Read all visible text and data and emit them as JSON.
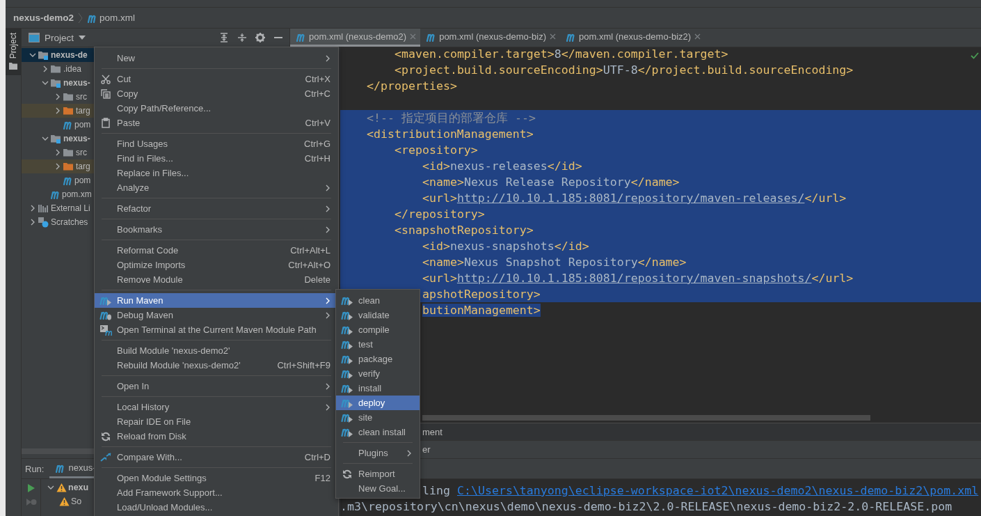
{
  "breadcrumb": [
    {
      "label": "nexus-demo2",
      "kind": "project"
    },
    {
      "label": "pom.xml",
      "kind": "maven"
    }
  ],
  "tool_windows": [
    {
      "label": "Project",
      "selected": true
    }
  ],
  "project_panel": {
    "title": "Project",
    "tree": [
      {
        "label": "nexus-de",
        "kind": "module",
        "expanded": true,
        "selected": true,
        "children": [
          {
            "label": ".idea",
            "kind": "folder",
            "expanded": false,
            "selected": false
          },
          {
            "label": "nexus-",
            "kind": "module",
            "expanded": true,
            "selected": false,
            "children": [
              {
                "label": "src",
                "kind": "folder",
                "expanded": false,
                "selected": false
              },
              {
                "label": "targ",
                "kind": "excluded",
                "expanded": false,
                "selected": false
              },
              {
                "label": "pom",
                "kind": "maven",
                "selected": false
              }
            ]
          },
          {
            "label": "nexus-",
            "kind": "module",
            "expanded": true,
            "selected": false,
            "children": [
              {
                "label": "src",
                "kind": "folder",
                "expanded": false,
                "selected": false
              },
              {
                "label": "targ",
                "kind": "excluded",
                "expanded": false,
                "selected": false
              },
              {
                "label": "pom",
                "kind": "maven",
                "selected": false
              }
            ]
          },
          {
            "label": "pom.xm",
            "kind": "maven",
            "selected": false
          }
        ]
      },
      {
        "label": "External Li",
        "kind": "library",
        "expanded": false,
        "selected": false
      },
      {
        "label": "Scratches",
        "kind": "scratch",
        "expanded": false,
        "selected": false
      }
    ]
  },
  "editor_tabs": [
    {
      "label": "pom.xml (nexus-demo2)",
      "selected": true
    },
    {
      "label": "pom.xml (nexus-demo-biz)",
      "selected": false
    },
    {
      "label": "pom.xml (nexus-demo-biz2)",
      "selected": false
    }
  ],
  "editor": {
    "lines": [
      {
        "selected": false,
        "segments": [
          {
            "kind": "tag",
            "text": "    <maven.compiler.target>"
          },
          {
            "kind": "text",
            "text": "8"
          },
          {
            "kind": "tag",
            "text": "</maven.compiler.target>"
          }
        ]
      },
      {
        "selected": false,
        "segments": [
          {
            "kind": "tag",
            "text": "    <project.build.sourceEncoding>"
          },
          {
            "kind": "text",
            "text": "UTF-8"
          },
          {
            "kind": "tag",
            "text": "</project.build.sourceEncoding>"
          }
        ]
      },
      {
        "selected": false,
        "segments": [
          {
            "kind": "tag",
            "text": "</properties>"
          }
        ]
      },
      {
        "selected": false
      },
      {
        "selected": true,
        "segments": [
          {
            "kind": "comment",
            "text": "<!-- 指定项目的部署仓库 -->"
          }
        ]
      },
      {
        "selected": true,
        "segments": [
          {
            "kind": "tag",
            "text": "<distributionManagement>"
          }
        ]
      },
      {
        "selected": true,
        "segments": [
          {
            "kind": "tag",
            "text": "    <repository>"
          }
        ]
      },
      {
        "selected": true,
        "segments": [
          {
            "kind": "tag",
            "text": "        <id>"
          },
          {
            "kind": "text",
            "text": "nexus-releases"
          },
          {
            "kind": "tag",
            "text": "</id>"
          }
        ]
      },
      {
        "selected": true,
        "segments": [
          {
            "kind": "tag",
            "text": "        <name>"
          },
          {
            "kind": "text",
            "text": "Nexus Release Repository"
          },
          {
            "kind": "tag",
            "text": "</name>"
          }
        ]
      },
      {
        "selected": true,
        "segments": [
          {
            "kind": "tag",
            "text": "        <url>"
          },
          {
            "kind": "link",
            "text": "http://10.10.1.185:8081/repository/maven-releases/"
          },
          {
            "kind": "tag",
            "text": "</url>"
          }
        ]
      },
      {
        "selected": true,
        "segments": [
          {
            "kind": "tag",
            "text": "    </repository>"
          }
        ]
      },
      {
        "selected": true,
        "segments": [
          {
            "kind": "tag",
            "text": "    <snapshotRepository>"
          }
        ]
      },
      {
        "selected": true,
        "segments": [
          {
            "kind": "tag",
            "text": "        <id>"
          },
          {
            "kind": "text",
            "text": "nexus-snapshots"
          },
          {
            "kind": "tag",
            "text": "</id>"
          }
        ]
      },
      {
        "selected": true,
        "segments": [
          {
            "kind": "tag",
            "text": "        <name>"
          },
          {
            "kind": "text",
            "text": "Nexus Snapshot Repository"
          },
          {
            "kind": "tag",
            "text": "</name>"
          }
        ]
      },
      {
        "selected": true,
        "segments": [
          {
            "kind": "tag",
            "text": "        <url>"
          },
          {
            "kind": "link",
            "text": "http://10.10.1.185:8081/repository/maven-snapshots/"
          },
          {
            "kind": "tag",
            "text": "</url>"
          }
        ]
      },
      {
        "selected": true,
        "clipped": true,
        "segments": [
          {
            "kind": "tag",
            "text": "apshotRepository>"
          }
        ]
      },
      {
        "selected": true,
        "clipped": true,
        "segments": [
          {
            "kind": "tag",
            "text": "butionManagement>"
          }
        ]
      }
    ]
  },
  "editor_footer": [
    {
      "text": "ment"
    },
    {
      "text": "er"
    }
  ],
  "run_panel": {
    "label": "Run:",
    "tab": {
      "label": "nexus-",
      "selected": true
    },
    "tree": [
      {
        "label": "nexu",
        "kind": "warning",
        "expanded": true,
        "children": [
          {
            "label": "So",
            "kind": "warning"
          }
        ]
      }
    ],
    "console": [
      {
        "clipped": true,
        "segments": [
          {
            "kind": "text",
            "text": "ling "
          },
          {
            "kind": "link",
            "text": "C:\\Users\\tanyong\\eclipse-workspace-iot2\\nexus-demo2\\nexus-demo-biz2\\pom.xml"
          }
        ]
      },
      {
        "segments": [
          {
            "kind": "text",
            "text": ".m3\\repository\\cn\\nexus\\demo\\nexus-demo-biz2\\2.0-RELEASE\\nexus-demo-biz2-2.0-RELEASE.pom"
          }
        ]
      }
    ]
  },
  "context_menu": {
    "items": [
      {
        "kind": "plain",
        "label": "New",
        "submenu": true,
        "selected": false
      },
      {
        "kind": "separator"
      },
      {
        "kind": "scissors",
        "label": "Cut",
        "shortcut": "Ctrl+X",
        "selected": false
      },
      {
        "kind": "copy",
        "label": "Copy",
        "shortcut": "Ctrl+C",
        "selected": false
      },
      {
        "kind": "plain",
        "label": "Copy Path/Reference...",
        "selected": false
      },
      {
        "kind": "paste",
        "label": "Paste",
        "shortcut": "Ctrl+V",
        "selected": false
      },
      {
        "kind": "separator"
      },
      {
        "kind": "plain",
        "label": "Find Usages",
        "shortcut": "Ctrl+G",
        "selected": false
      },
      {
        "kind": "plain",
        "label": "Find in Files...",
        "shortcut": "Ctrl+H",
        "selected": false
      },
      {
        "kind": "plain",
        "label": "Replace in Files...",
        "selected": false
      },
      {
        "kind": "plain",
        "label": "Analyze",
        "submenu": true,
        "selected": false
      },
      {
        "kind": "separator"
      },
      {
        "kind": "plain",
        "label": "Refactor",
        "submenu": true,
        "selected": false
      },
      {
        "kind": "separator"
      },
      {
        "kind": "plain",
        "label": "Bookmarks",
        "submenu": true,
        "selected": false
      },
      {
        "kind": "separator"
      },
      {
        "kind": "plain",
        "label": "Reformat Code",
        "shortcut": "Ctrl+Alt+L",
        "selected": false
      },
      {
        "kind": "plain",
        "label": "Optimize Imports",
        "shortcut": "Ctrl+Alt+O",
        "selected": false
      },
      {
        "kind": "plain",
        "label": "Remove Module",
        "shortcut": "Delete",
        "selected": false
      },
      {
        "kind": "separator"
      },
      {
        "kind": "maven-run",
        "label": "Run Maven",
        "submenu": true,
        "selected": true
      },
      {
        "kind": "maven-debug",
        "label": "Debug Maven",
        "submenu": true,
        "selected": false
      },
      {
        "kind": "terminal",
        "label": "Open Terminal at the Current Maven Module Path",
        "selected": false
      },
      {
        "kind": "separator"
      },
      {
        "kind": "plain",
        "label": "Build Module 'nexus-demo2'",
        "selected": false
      },
      {
        "kind": "plain",
        "label": "Rebuild Module 'nexus-demo2'",
        "shortcut": "Ctrl+Shift+F9",
        "selected": false
      },
      {
        "kind": "separator"
      },
      {
        "kind": "plain",
        "label": "Open In",
        "submenu": true,
        "selected": false
      },
      {
        "kind": "separator"
      },
      {
        "kind": "plain",
        "label": "Local History",
        "submenu": true,
        "selected": false
      },
      {
        "kind": "plain",
        "label": "Repair IDE on File",
        "selected": false
      },
      {
        "kind": "reload",
        "label": "Reload from Disk",
        "selected": false
      },
      {
        "kind": "separator"
      },
      {
        "kind": "compare",
        "label": "Compare With...",
        "shortcut": "Ctrl+D",
        "selected": false
      },
      {
        "kind": "separator"
      },
      {
        "kind": "plain",
        "label": "Open Module Settings",
        "shortcut": "F12",
        "selected": false
      },
      {
        "kind": "plain",
        "label": "Add Framework Support...",
        "selected": false
      },
      {
        "kind": "plain",
        "label": "Load/Unload Modules...",
        "selected": false
      }
    ]
  },
  "submenu": {
    "items": [
      {
        "kind": "maven-run",
        "label": "clean",
        "selected": false
      },
      {
        "kind": "maven-run",
        "label": "validate",
        "selected": false
      },
      {
        "kind": "maven-run",
        "label": "compile",
        "selected": false
      },
      {
        "kind": "maven-run",
        "label": "test",
        "selected": false
      },
      {
        "kind": "maven-run",
        "label": "package",
        "selected": false
      },
      {
        "kind": "maven-run",
        "label": "verify",
        "selected": false
      },
      {
        "kind": "maven-run",
        "label": "install",
        "selected": false
      },
      {
        "kind": "maven-run",
        "label": "deploy",
        "selected": true
      },
      {
        "kind": "maven-run",
        "label": "site",
        "selected": false
      },
      {
        "kind": "maven-run",
        "label": "clean install",
        "selected": false
      },
      {
        "kind": "separator"
      },
      {
        "kind": "plain",
        "label": "Plugins",
        "submenu": true,
        "selected": false
      },
      {
        "kind": "separator"
      },
      {
        "kind": "reload",
        "label": "Reimport",
        "selected": false
      },
      {
        "kind": "plain",
        "label": "New Goal...",
        "selected": false
      }
    ]
  }
}
